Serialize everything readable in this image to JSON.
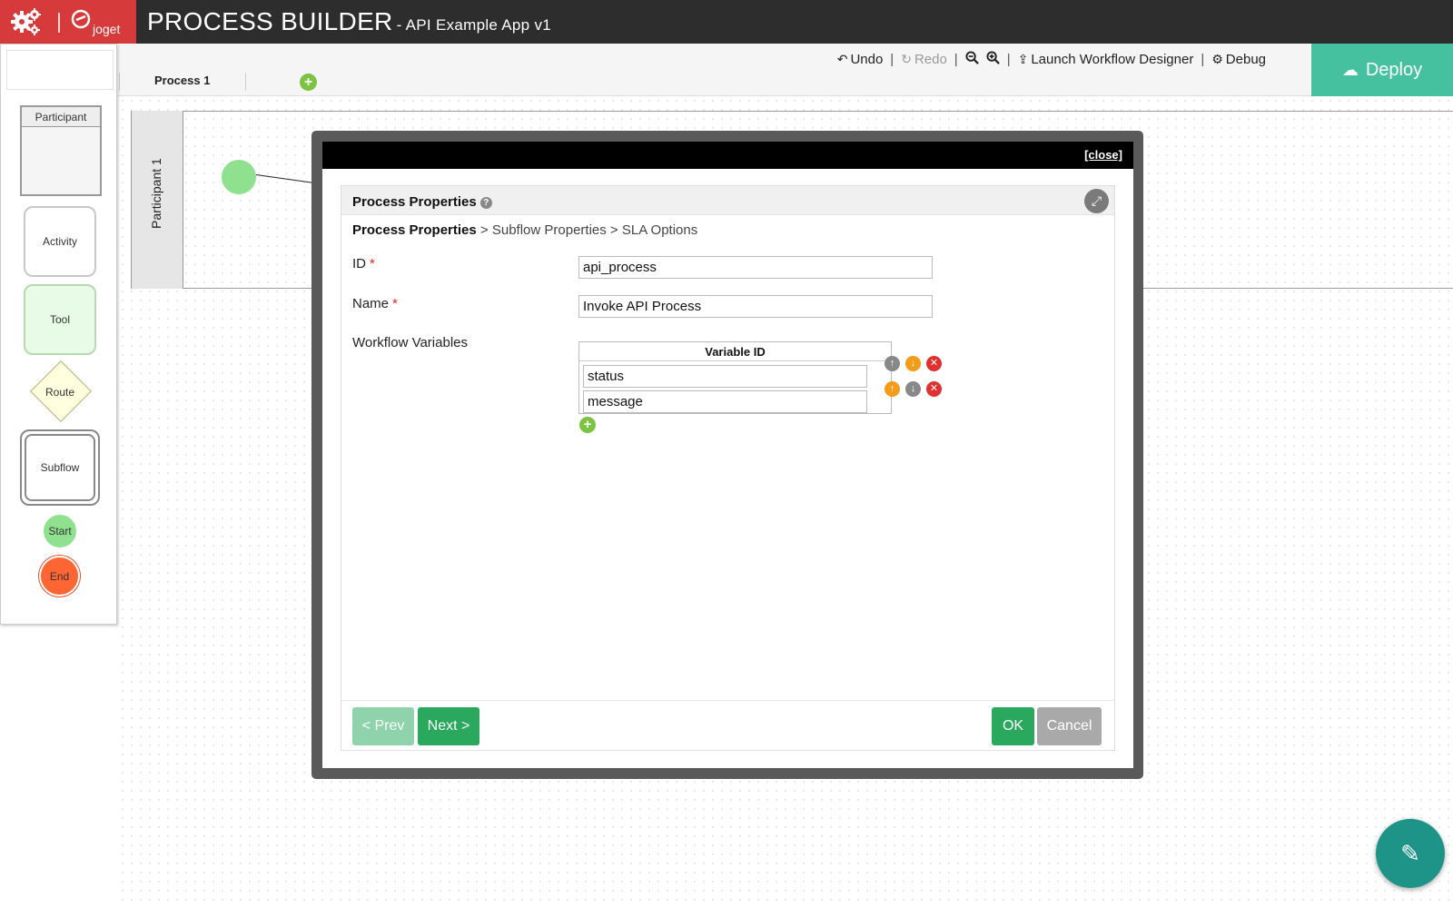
{
  "header": {
    "brand": "joget",
    "title": "PROCESS BUILDER",
    "subtitle": "- API Example App v1"
  },
  "tabs": [
    {
      "label": "Process 1"
    }
  ],
  "toolbar": {
    "undo": "Undo",
    "redo": "Redo",
    "launch": "Launch Workflow Designer",
    "debug": "Debug",
    "deploy": "Deploy"
  },
  "palette": {
    "participant": "Participant",
    "activity": "Activity",
    "tool": "Tool",
    "route": "Route",
    "subflow": "Subflow",
    "start": "Start",
    "end": "End"
  },
  "canvas": {
    "lane_label": "Participant 1"
  },
  "dialog": {
    "close": "[close]",
    "panel_title": "Process Properties",
    "breadcrumb": {
      "current": "Process Properties",
      "step2": "> Subflow Properties",
      "step3": "> SLA Options"
    },
    "fields": {
      "id_label": "ID",
      "id_value": "api_process",
      "name_label": "Name",
      "name_value": "Invoke API Process",
      "vars_label": "Workflow Variables",
      "vars_header": "Variable ID",
      "vars": [
        "status",
        "message"
      ]
    },
    "buttons": {
      "prev": "< Prev",
      "next": "Next >",
      "ok": "OK",
      "cancel": "Cancel"
    }
  },
  "colors": {
    "header_bg": "#2d2d2d",
    "logo_bg": "#d63a3a",
    "deploy_bg": "#46c1a0",
    "primary_button": "#2aa85d",
    "fab_bg": "#1e9488"
  }
}
